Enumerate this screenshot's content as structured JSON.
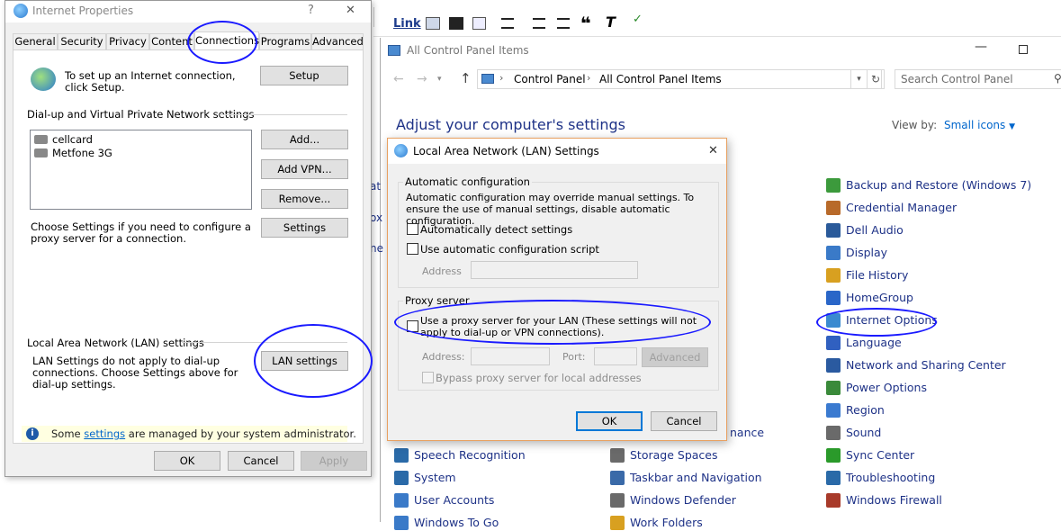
{
  "editor_toolbar": {
    "link_label": "Link",
    "icons": [
      "image-icon",
      "film-icon",
      "dialog-icon",
      "align-icon",
      "numbered-list-icon",
      "bulleted-list-icon",
      "quote-icon",
      "clear-format-icon",
      "spellcheck-icon"
    ]
  },
  "control_panel": {
    "title": "All Control Panel Items",
    "breadcrumb": [
      "Control Panel",
      "All Control Panel Items"
    ],
    "search_placeholder": "Search Control Panel",
    "heading": "Adjust your computer's settings",
    "view_by_label": "View by:",
    "view_by_value": "Small icons",
    "col3": [
      {
        "label": "Backup and Restore (Windows 7)",
        "color": "#3c9a3c"
      },
      {
        "label": "Credential Manager",
        "color": "#b86a2a"
      },
      {
        "label": "Dell Audio",
        "color": "#2a5a9a"
      },
      {
        "label": "Display",
        "color": "#3a7ac8"
      },
      {
        "label": "File History",
        "color": "#d8a020"
      },
      {
        "label": "HomeGroup",
        "color": "#2a66c8"
      },
      {
        "label": "Internet Options",
        "color": "#3a8ad0"
      },
      {
        "label": "Language",
        "color": "#3060c0"
      },
      {
        "label": "Network and Sharing Center",
        "color": "#2a5aa0"
      },
      {
        "label": "Power Options",
        "color": "#3a8a3a"
      },
      {
        "label": "Region",
        "color": "#3a7ad0"
      },
      {
        "label": "Sound",
        "color": "#6a6a6a"
      },
      {
        "label": "Sync Center",
        "color": "#2a9a2a"
      },
      {
        "label": "Troubleshooting",
        "color": "#2a6aa8"
      },
      {
        "label": "Windows Firewall",
        "color": "#a83a2a"
      }
    ],
    "col1": [
      {
        "label": "Speech Recognition",
        "color": "#2a6aa8"
      },
      {
        "label": "System",
        "color": "#2a6aa8"
      },
      {
        "label": "User Accounts",
        "color": "#3a7ac8"
      },
      {
        "label": "Windows To Go",
        "color": "#3a7ac8"
      }
    ],
    "col2": [
      {
        "label": "Storage Spaces",
        "color": "#6a6a6a"
      },
      {
        "label": "Taskbar and Navigation",
        "color": "#3a6aa8"
      },
      {
        "label": "Windows Defender",
        "color": "#6a6a6a"
      },
      {
        "label": "Work Folders",
        "color": "#d8a020"
      }
    ],
    "partial_text": "nance",
    "left_partial": [
      "at",
      "ox",
      "ne"
    ]
  },
  "internet_props": {
    "title": "Internet Properties",
    "help_glyph": "?",
    "close_glyph": "✕",
    "tabs": [
      "General",
      "Security",
      "Privacy",
      "Content",
      "Connections",
      "Programs",
      "Advanced"
    ],
    "setup_text": "To set up an Internet connection, click Setup.",
    "setup_button": "Setup",
    "dialup_heading": "Dial-up and Virtual Private Network settings",
    "connections": [
      "cellcard",
      "Metfone 3G"
    ],
    "add_button": "Add...",
    "addvpn_button": "Add VPN...",
    "remove_button": "Remove...",
    "settings_text": "Choose Settings if you need to configure a proxy server for a connection.",
    "settings_button": "Settings",
    "lan_heading": "Local Area Network (LAN) settings",
    "lan_text": "LAN Settings do not apply to dial-up connections. Choose Settings above for dial-up settings.",
    "lan_button": "LAN settings",
    "info_prefix": "Some ",
    "info_link": "settings",
    "info_suffix": " are managed by your system administrator.",
    "ok": "OK",
    "cancel": "Cancel",
    "apply": "Apply"
  },
  "lan_dialog": {
    "title": "Local Area Network (LAN) Settings",
    "close_glyph": "✕",
    "auto_group": "Automatic configuration",
    "auto_desc": "Automatic configuration may override manual settings.  To ensure the use of manual settings, disable automatic configuration.",
    "auto_detect": "Automatically detect settings",
    "auto_script": "Use automatic configuration script",
    "address_label": "Address",
    "proxy_group": "Proxy server",
    "proxy_use": "Use a proxy server for your LAN (These settings will not apply to dial-up or VPN connections).",
    "proxy_address_label": "Address:",
    "proxy_port_label": "Port:",
    "advanced_button": "Advanced",
    "bypass": "Bypass proxy server for local addresses",
    "ok": "OK",
    "cancel": "Cancel"
  }
}
